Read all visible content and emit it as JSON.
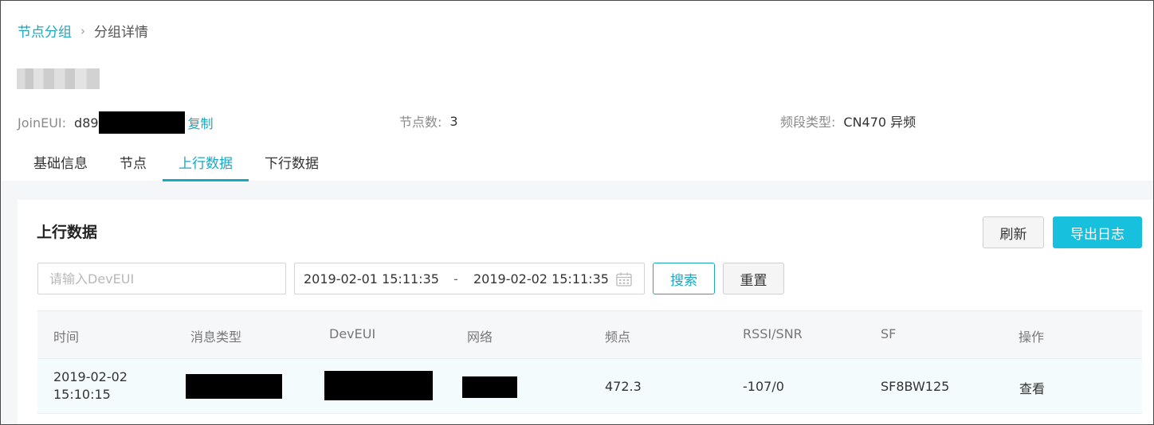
{
  "breadcrumb": {
    "parent": "节点分组",
    "separator": "›",
    "current": "分组详情"
  },
  "meta": {
    "join_eui_label": "JoinEUI:",
    "join_eui_value": "d89",
    "copy_label": "复制",
    "node_count_label": "节点数:",
    "node_count_value": "3",
    "band_label": "频段类型:",
    "band_value": "CN470 异频"
  },
  "tabs": [
    {
      "label": "基础信息"
    },
    {
      "label": "节点"
    },
    {
      "label": "上行数据"
    },
    {
      "label": "下行数据"
    }
  ],
  "active_tab": "上行数据",
  "card": {
    "title": "上行数据",
    "refresh_label": "刷新",
    "export_label": "导出日志",
    "search_placeholder": "请输入DevEUI",
    "date_start": "2019-02-01 15:11:35",
    "date_separator": "-",
    "date_end": "2019-02-02 15:11:35",
    "search_button": "搜索",
    "reset_button": "重置"
  },
  "table": {
    "columns": [
      "时间",
      "消息类型",
      "DevEUI",
      "网络",
      "频点",
      "RSSI/SNR",
      "SF",
      "操作"
    ],
    "rows": [
      {
        "time": "2019-02-02 15:10:15",
        "frequency": "472.3",
        "rssi_snr": "-107/0",
        "sf": "SF8BW125",
        "action": "查看"
      }
    ]
  },
  "colors": {
    "accent": "#1aa7c2",
    "export_bg": "#17c1dd",
    "redaction": "#000000"
  },
  "icons": {
    "calendar": "calendar-icon",
    "breadcrumb_separator": "chevron-right-icon"
  }
}
